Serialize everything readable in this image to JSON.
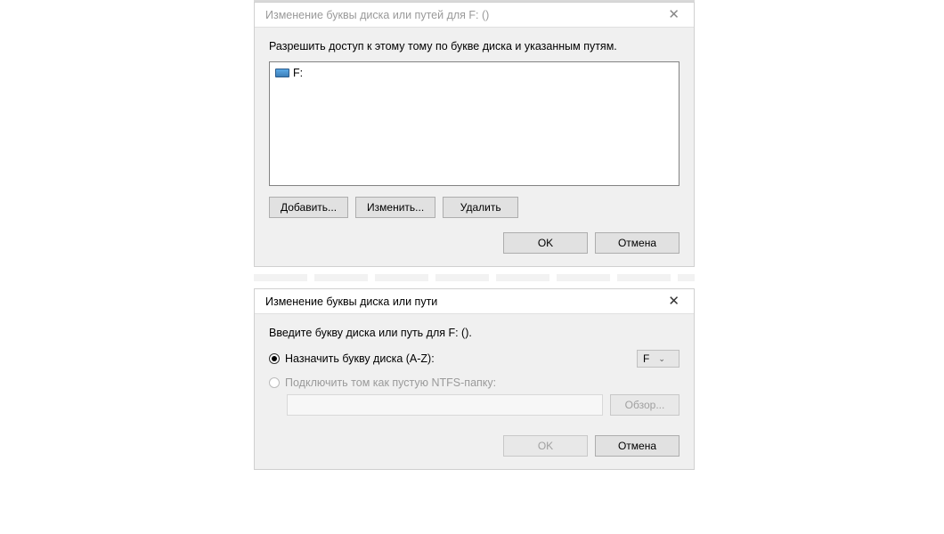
{
  "dialog1": {
    "title": "Изменение буквы диска или путей для F: ()",
    "instruction": "Разрешить доступ к этому тому по букве диска и указанным путям.",
    "list_item": "F:",
    "buttons": {
      "add": "Добавить...",
      "change": "Изменить...",
      "remove": "Удалить"
    },
    "footer": {
      "ok": "OK",
      "cancel": "Отмена"
    }
  },
  "dialog2": {
    "title": "Изменение буквы диска или пути",
    "prompt": "Введите букву диска или путь для F: ().",
    "option_assign": "Назначить букву диска (A-Z):",
    "option_mount": "Подключить том как пустую NTFS-папку:",
    "dropdown_value": "F",
    "browse": "Обзор...",
    "footer": {
      "ok": "OK",
      "cancel": "Отмена"
    }
  }
}
